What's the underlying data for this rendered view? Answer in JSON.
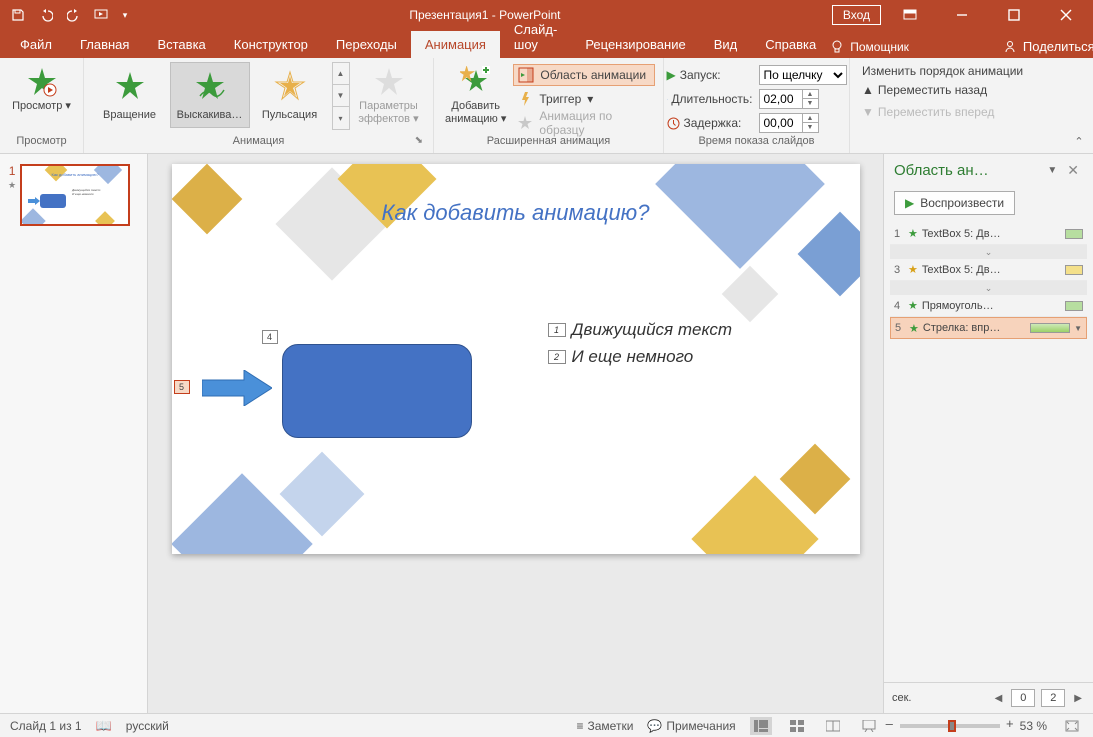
{
  "title": "Презентация1 - PowerPoint",
  "login": "Вход",
  "tabs": [
    "Файл",
    "Главная",
    "Вставка",
    "Конструктор",
    "Переходы",
    "Анимация",
    "Слайд-шоу",
    "Рецензирование",
    "Вид",
    "Справка"
  ],
  "active_tab": 5,
  "assistant": "Помощник",
  "share": "Поделиться",
  "ribbon": {
    "preview": {
      "btn": "Просмотр",
      "group": "Просмотр"
    },
    "effects": {
      "items": [
        {
          "name": "Вращение"
        },
        {
          "name": "Выскакива…"
        },
        {
          "name": "Пульсация"
        }
      ],
      "selected": 1,
      "params": "Параметры\nэффектов",
      "group": "Анимация"
    },
    "advanced": {
      "add": "Добавить\nанимацию",
      "pane": "Область анимации",
      "trigger": "Триггер",
      "painter": "Анимация по образцу",
      "group": "Расширенная анимация"
    },
    "timing": {
      "start_lbl": "Запуск:",
      "start_val": "По щелчку",
      "duration_lbl": "Длительность:",
      "duration_val": "02,00",
      "delay_lbl": "Задержка:",
      "delay_val": "00,00",
      "group": "Время показа слайдов"
    },
    "reorder": {
      "header": "Изменить порядок анимации",
      "back": "Переместить назад",
      "fwd": "Переместить вперед"
    }
  },
  "thumb": {
    "num": "1"
  },
  "slide": {
    "title": "Как добавить анимацию?",
    "line1": "Движущийся текст",
    "line2": "И еще немного",
    "tag1": "1",
    "tag2": "2",
    "tag4": "4",
    "tag5": "5"
  },
  "pane": {
    "title": "Область ан…",
    "play": "Воспроизвести",
    "items": [
      {
        "n": "1",
        "name": "TextBox 5: Дв…",
        "color": "#b7dea0",
        "star": "g"
      },
      {
        "n": "3",
        "name": "TextBox 5: Дв…",
        "color": "#f4e08a",
        "star": "y"
      },
      {
        "n": "4",
        "name": "Прямоуголь…",
        "color": "#b7dea0",
        "star": "g"
      },
      {
        "n": "5",
        "name": "Стрелка: впр…",
        "color": "#9cd168",
        "star": "g",
        "sel": true
      }
    ],
    "sec": "сек.",
    "t0": "0",
    "t1": "2"
  },
  "status": {
    "slide": "Слайд 1 из 1",
    "lang": "русский",
    "notes": "Заметки",
    "comments": "Примечания",
    "zoom": "53 %"
  }
}
